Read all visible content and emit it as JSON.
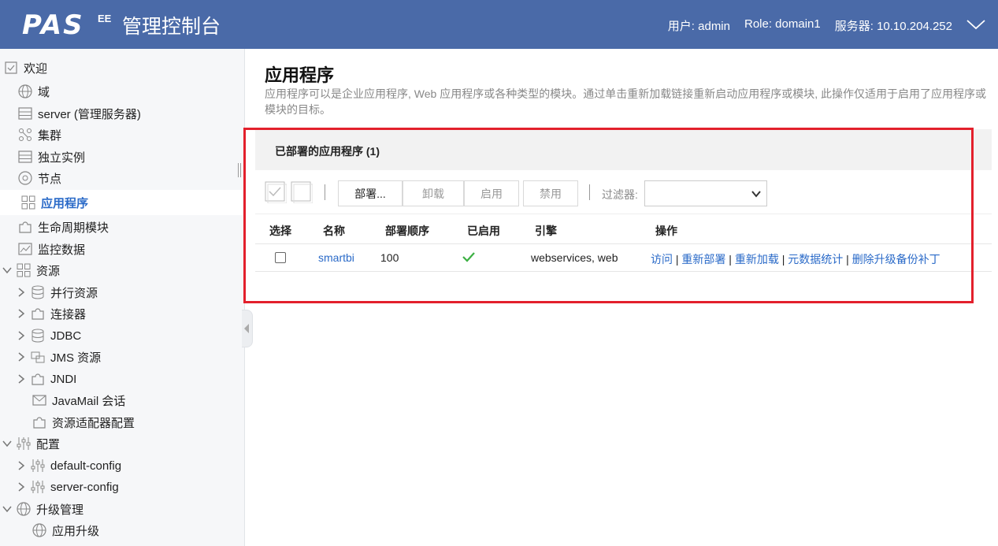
{
  "header": {
    "logo": "PAS",
    "logo_sup": "EE",
    "title": "管理控制台",
    "user": "用户: admin",
    "role": "Role: domain1",
    "server": "服务器: 10.10.204.252",
    "toggle_icon": "chevron-down-icon"
  },
  "sidebar": {
    "items": [
      {
        "label": "欢迎",
        "icon": "checklist-icon"
      },
      {
        "label": "域",
        "icon": "globe-icon"
      },
      {
        "label": "server (管理服务器)",
        "icon": "server-icon"
      },
      {
        "label": "集群",
        "icon": "cluster-icon"
      },
      {
        "label": "独立实例",
        "icon": "server-icon"
      },
      {
        "label": "节点",
        "icon": "node-icon"
      },
      {
        "label": "应用程序",
        "icon": "apps-grid-icon"
      },
      {
        "label": "生命周期模块",
        "icon": "puzzle-icon"
      },
      {
        "label": "监控数据",
        "icon": "chart-icon"
      },
      {
        "label": "资源",
        "icon": "apps-grid-icon"
      },
      {
        "label": "并行资源",
        "icon": "database-icon"
      },
      {
        "label": "连接器",
        "icon": "puzzle-icon"
      },
      {
        "label": "JDBC",
        "icon": "database-icon"
      },
      {
        "label": "JMS 资源",
        "icon": "message-queue-icon"
      },
      {
        "label": "JNDI",
        "icon": "puzzle-icon"
      },
      {
        "label": "JavaMail 会话",
        "icon": "mail-icon"
      },
      {
        "label": "资源适配器配置",
        "icon": "puzzle-icon"
      },
      {
        "label": "配置",
        "icon": "sliders-icon"
      },
      {
        "label": "default-config",
        "icon": "sliders-icon"
      },
      {
        "label": "server-config",
        "icon": "sliders-icon"
      },
      {
        "label": "升级管理",
        "icon": "globe-icon"
      },
      {
        "label": "应用升级",
        "icon": "globe-icon"
      }
    ]
  },
  "main": {
    "title": "应用程序",
    "description": "应用程序可以是企业应用程序, Web 应用程序或各种类型的模块。通过单击重新加载链接重新启动应用程序或模块, 此操作仅适用于启用了应用程序或模块的目标。",
    "panel_title": "已部署的应用程序 (1)",
    "toolbar": {
      "deploy": "部署...",
      "undeploy": "卸载",
      "enable": "启用",
      "disable": "禁用",
      "filter_label": "过滤器:",
      "filter_value": ""
    },
    "table": {
      "columns": [
        "选择",
        "名称",
        "部署顺序",
        "已启用",
        "引擎",
        "操作"
      ],
      "rows": [
        {
          "name": "smartbi",
          "order": "100",
          "enabled": true,
          "engine": "webservices, web",
          "actions": [
            "访问",
            "重新部署",
            "重新加载",
            "元数据统计",
            "删除升级备份补丁"
          ]
        }
      ]
    }
  },
  "colors": {
    "header_bg": "#4a6aa8",
    "link": "#2a6ac8",
    "highlight": "#e3202c",
    "check": "#3cb043"
  }
}
